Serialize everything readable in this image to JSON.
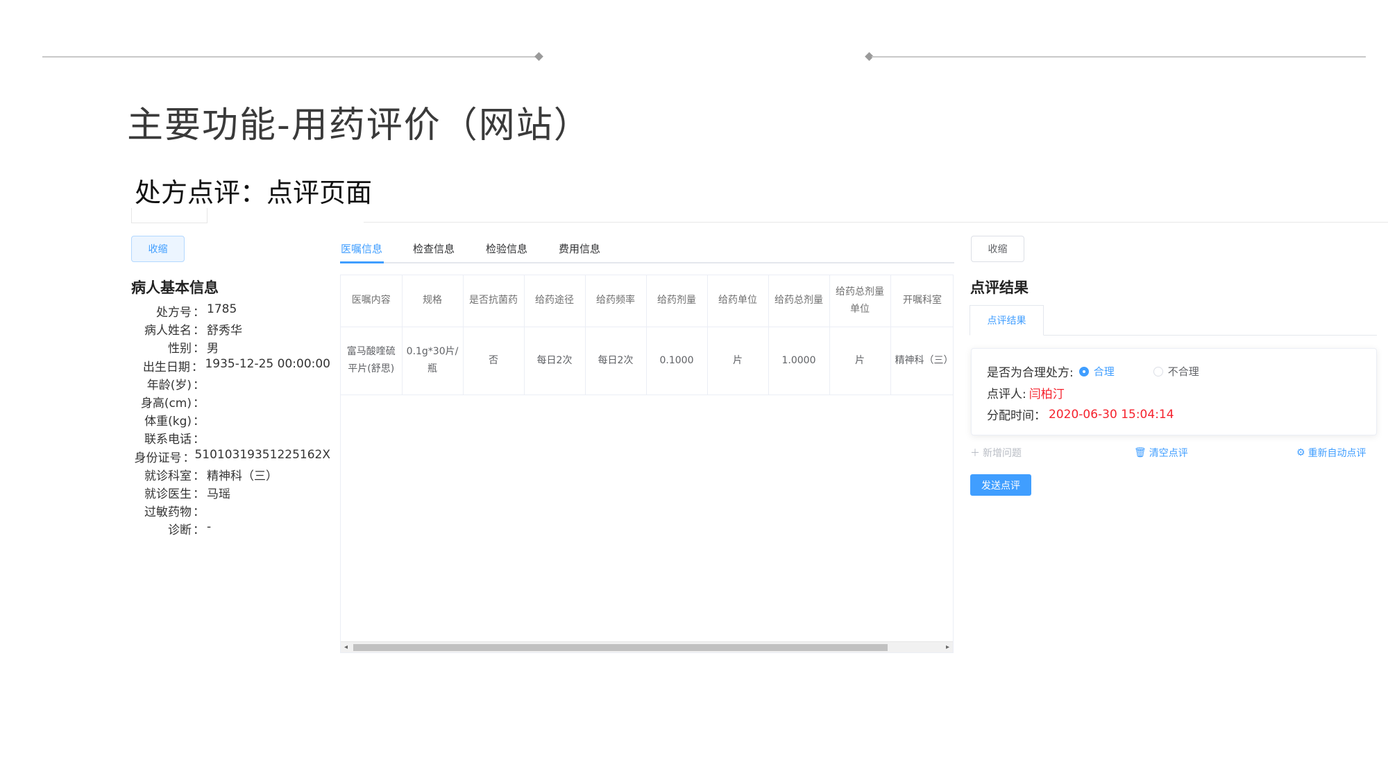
{
  "slide": {
    "title": "主要功能-用药评价（网站）",
    "subtitle": "处方点评：点评页面"
  },
  "left_panel": {
    "collapse_label": "收缩",
    "section_title": "病人基本信息",
    "fields": [
      {
        "label": "处方号",
        "value": "1785"
      },
      {
        "label": "病人姓名",
        "value": "舒秀华"
      },
      {
        "label": "性别",
        "value": "男"
      },
      {
        "label": "出生日期",
        "value": "1935-12-25 00:00:00"
      },
      {
        "label": "年龄(岁)",
        "value": ""
      },
      {
        "label": "身高(cm)",
        "value": ""
      },
      {
        "label": "体重(kg)",
        "value": ""
      },
      {
        "label": "联系电话",
        "value": ""
      },
      {
        "label": "身份证号",
        "value": "51010319351225162X"
      },
      {
        "label": "就诊科室",
        "value": "精神科（三）"
      },
      {
        "label": "就诊医生",
        "value": "马瑶"
      },
      {
        "label": "过敏药物",
        "value": ""
      },
      {
        "label": "诊断",
        "value": "-"
      }
    ]
  },
  "middle_panel": {
    "tabs": [
      "医嘱信息",
      "检查信息",
      "检验信息",
      "费用信息"
    ],
    "active_tab": "医嘱信息",
    "table": {
      "headers": [
        "医嘱内容",
        "规格",
        "是否抗菌药",
        "给药途径",
        "给药频率",
        "给药剂量",
        "给药单位",
        "给药总剂量",
        "给药总剂量单位",
        "开嘱科室"
      ],
      "rows": [
        [
          "富马酸喹硫平片(舒思)",
          "0.1g*30片/瓶",
          "否",
          "每日2次",
          "每日2次",
          "0.1000",
          "片",
          "1.0000",
          "片",
          "精神科（三）"
        ]
      ]
    }
  },
  "right_panel": {
    "collapse_label": "收缩",
    "section_title": "点评结果",
    "tab_label": "点评结果",
    "reasonable_label": "是否为合理处方:",
    "options": [
      "合理",
      "不合理"
    ],
    "selected_option": "合理",
    "reviewer_label": "点评人:",
    "reviewer_value": "闫柏汀",
    "assign_time_label": "分配时间：",
    "assign_time_value": "2020-06-30 15:04:14",
    "add_issue_label": "新增问题",
    "clear_label": "清空点评",
    "auto_review_label": "重新自动点评",
    "send_label": "发送点评"
  },
  "colors": {
    "primary": "#409eff",
    "danger": "#f5222d"
  }
}
